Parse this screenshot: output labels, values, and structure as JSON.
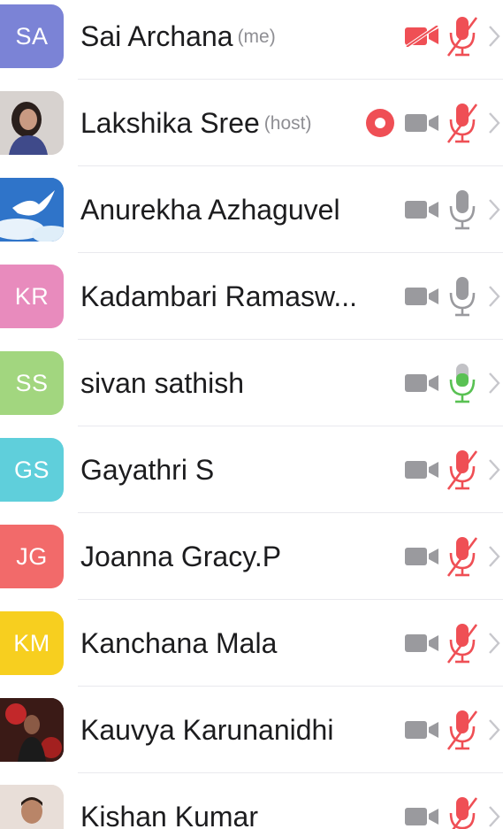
{
  "colors": {
    "muted_red": "#ef4f55",
    "icon_gray": "#9a9a9e",
    "active_green": "#59c153",
    "chevron_gray": "#c7c7cc"
  },
  "participants": [
    {
      "initials": "SA",
      "name": "Sai Archana",
      "role": "(me)",
      "avatar_type": "initials",
      "avatar_color": "#7b83d6",
      "video": "off",
      "mic": "muted",
      "recording": false
    },
    {
      "initials": "",
      "name": "Lakshika Sree",
      "role": "(host)",
      "avatar_type": "photo-woman",
      "avatar_color": "#d7d2cf",
      "video": "on",
      "mic": "muted",
      "recording": true
    },
    {
      "initials": "",
      "name": "Anurekha Azhaguvel",
      "role": "",
      "avatar_type": "photo-bird",
      "avatar_color": "#2f74c9",
      "video": "on",
      "mic": "on",
      "recording": false
    },
    {
      "initials": "KR",
      "name": "Kadambari Ramasw...",
      "role": "",
      "avatar_type": "initials",
      "avatar_color": "#e88bbd",
      "video": "on",
      "mic": "on",
      "recording": false
    },
    {
      "initials": "SS",
      "name": "sivan sathish",
      "role": "",
      "avatar_type": "initials",
      "avatar_color": "#a2d67f",
      "video": "on",
      "mic": "talking",
      "recording": false
    },
    {
      "initials": "GS",
      "name": "Gayathri S",
      "role": "",
      "avatar_type": "initials",
      "avatar_color": "#5fcfdb",
      "video": "on",
      "mic": "muted",
      "recording": false
    },
    {
      "initials": "JG",
      "name": "Joanna Gracy.P",
      "role": "",
      "avatar_type": "initials",
      "avatar_color": "#f26a6a",
      "video": "on",
      "mic": "muted",
      "recording": false
    },
    {
      "initials": "KM",
      "name": "Kanchana Mala",
      "role": "",
      "avatar_type": "initials",
      "avatar_color": "#f7cf1f",
      "video": "on",
      "mic": "muted",
      "recording": false
    },
    {
      "initials": "",
      "name": "Kauvya Karunanidhi",
      "role": "",
      "avatar_type": "photo-dark",
      "avatar_color": "#3a1a16",
      "video": "on",
      "mic": "muted",
      "recording": false
    },
    {
      "initials": "",
      "name": "Kishan Kumar",
      "role": "",
      "avatar_type": "photo-man",
      "avatar_color": "#e8ded8",
      "video": "on",
      "mic": "muted",
      "recording": false
    }
  ]
}
